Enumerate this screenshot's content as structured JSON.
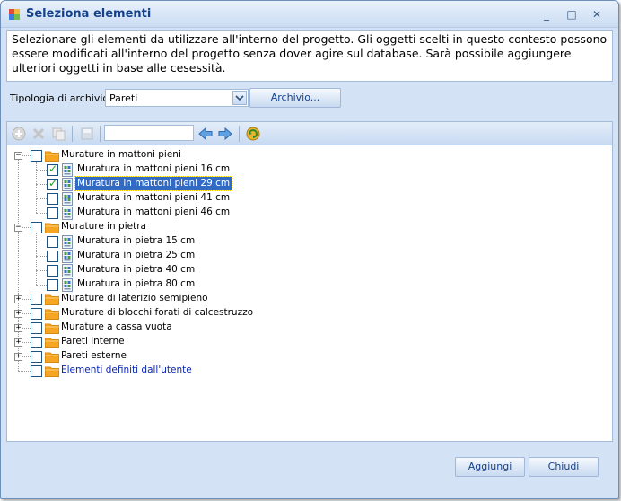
{
  "window": {
    "title": "Seleziona elementi",
    "controls": {
      "minimize": "_",
      "maximize": "□",
      "close": "✕"
    }
  },
  "info": {
    "text": "Selezionare gli elementi da utilizzare all'interno del progetto. Gli oggetti scelti in questo contesto possono essere modificati all'interno del progetto senza dover agire sul database. Sarà possibile aggiungere ulteriori oggetti in base alle cesessità."
  },
  "archive": {
    "label": "Tipologia di archivio",
    "selected": "Pareti",
    "button_label": "Archivio..."
  },
  "toolbar": {
    "icons": [
      "add-icon",
      "delete-icon",
      "copy-icon",
      "save-icon",
      "arrow-left-icon",
      "arrow-right-icon",
      "refresh-icon"
    ],
    "search_value": ""
  },
  "tree": {
    "groups": [
      {
        "label": "Murature in mattoni pieni",
        "expanded": true,
        "children": [
          {
            "label": "Muratura in mattoni pieni 16 cm",
            "checked": true,
            "selected": false
          },
          {
            "label": "Muratura in mattoni pieni 29 cm",
            "checked": true,
            "selected": true
          },
          {
            "label": "Muratura in mattoni pieni 41 cm",
            "checked": false,
            "selected": false
          },
          {
            "label": "Muratura in mattoni pieni 46 cm",
            "checked": false,
            "selected": false
          }
        ]
      },
      {
        "label": "Murature in pietra",
        "expanded": true,
        "children": [
          {
            "label": "Muratura in pietra 15 cm",
            "checked": false,
            "selected": false
          },
          {
            "label": "Muratura in pietra 25 cm",
            "checked": false,
            "selected": false
          },
          {
            "label": "Muratura in pietra 40 cm",
            "checked": false,
            "selected": false
          },
          {
            "label": "Muratura in pietra 80 cm",
            "checked": false,
            "selected": false
          }
        ]
      },
      {
        "label": "Murature di laterizio semipieno",
        "expanded": false,
        "children": []
      },
      {
        "label": "Murature di blocchi forati di calcestruzzo",
        "expanded": false,
        "children": []
      },
      {
        "label": "Murature a cassa vuota",
        "expanded": false,
        "children": []
      },
      {
        "label": "Pareti interne",
        "expanded": false,
        "children": []
      },
      {
        "label": "Pareti esterne",
        "expanded": false,
        "children": []
      },
      {
        "label": "Elementi definiti dall'utente",
        "expanded": false,
        "children": [],
        "leaf": true
      }
    ]
  },
  "footer": {
    "add_label": "Aggiungi",
    "close_label": "Chiudi"
  },
  "colors": {
    "title": "#15428b",
    "selection": "#316ac5",
    "link": "#0a24b4",
    "folder": "#f6a623",
    "check": "#21a121"
  }
}
